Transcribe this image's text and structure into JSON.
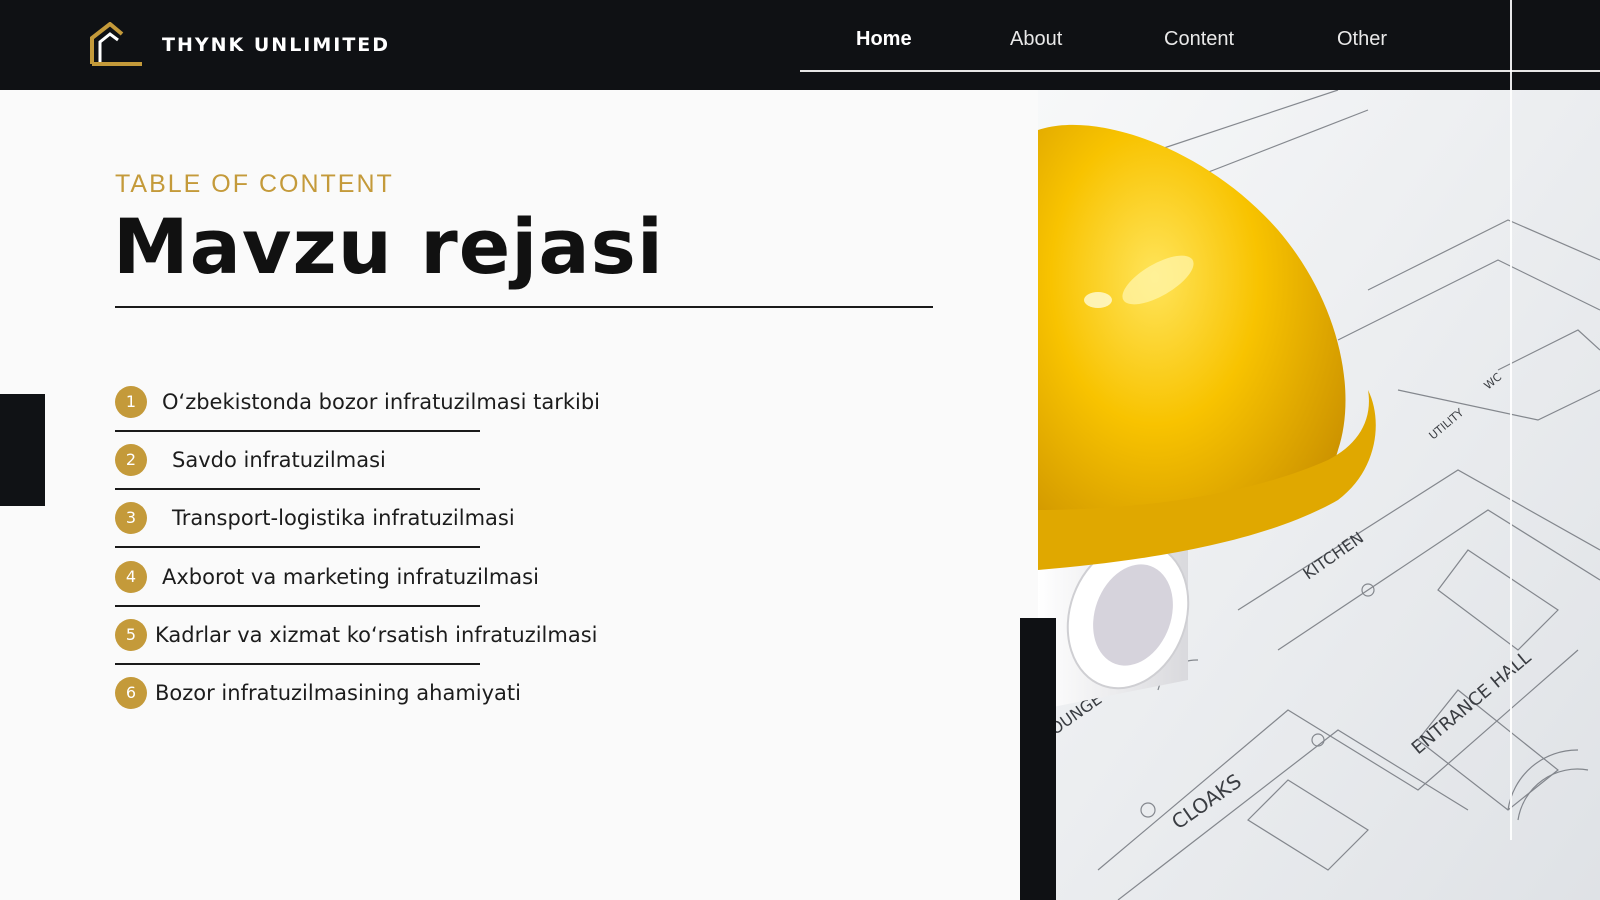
{
  "brand": {
    "name": "THYNK UNLIMITED",
    "logo_icon": "house-logo-icon"
  },
  "nav": {
    "items": [
      {
        "label": "Home",
        "active": true
      },
      {
        "label": "About",
        "active": false
      },
      {
        "label": "Content",
        "active": false
      },
      {
        "label": "Other",
        "active": false
      }
    ]
  },
  "heading": {
    "eyebrow": "TABLE OF CONTENT",
    "title": "Mavzu rejasi"
  },
  "toc": [
    {
      "number": "1",
      "label": "O‘zbekistonda bozor infratuzilmasi tarkibi"
    },
    {
      "number": "2",
      "label": "Savdo infratuzilmasi"
    },
    {
      "number": "3",
      "label": "Transport-logistika infratuzilmasi"
    },
    {
      "number": "4",
      "label": "Axborot va marketing infratuzilmasi"
    },
    {
      "number": "5",
      "label": "Kadrlar va xizmat ko‘rsatish infratuzilmasi"
    },
    {
      "number": "6",
      "label": "Bozor infratuzilmasining ahamiyati"
    }
  ],
  "photo": {
    "plan_labels": [
      "LOUNGE",
      "CLOAKS",
      "KITCHEN",
      "ENTRANCE HALL",
      "UTILITY",
      "WC"
    ]
  },
  "colors": {
    "accent": "#c49a3a",
    "dark": "#0f1114",
    "helmet": "#f5c400"
  }
}
